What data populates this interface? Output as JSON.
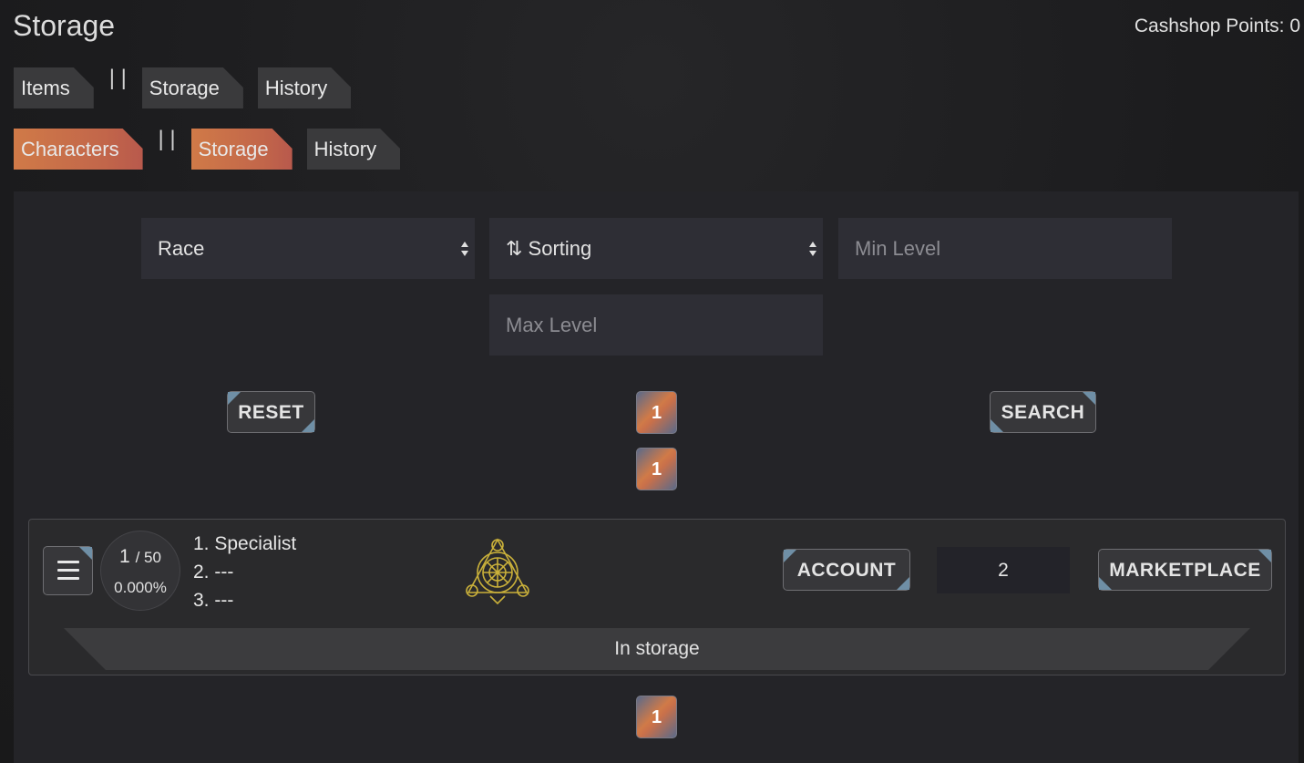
{
  "header": {
    "title": "Storage",
    "cashshop_label": "Cashshop Points: 0"
  },
  "items_tabs": {
    "items": "Items",
    "separator": "| |",
    "storage": "Storage",
    "history": "History"
  },
  "character_tabs": {
    "characters": "Characters",
    "separator": "| |",
    "storage": "Storage",
    "history": "History"
  },
  "filters": {
    "race": "Race",
    "sorting": "⇅ Sorting",
    "min_level_placeholder": "Min Level",
    "max_level_placeholder": "Max Level"
  },
  "buttons": {
    "reset": "RESET",
    "search": "SEARCH",
    "account": "ACCOUNT",
    "marketplace": "MARKETPLACE"
  },
  "pagination": {
    "top_page_1": "1",
    "top_page_2": "1",
    "bottom_page": "1"
  },
  "character": {
    "level": "1",
    "level_max": "/ 50",
    "exp_percent": "0.000%",
    "specs": [
      "1. Specialist",
      "2. ---",
      "3. ---"
    ],
    "quantity": "2",
    "status": "In storage"
  },
  "icons": {
    "menu": "hamburger-menu-icon",
    "emblem": "class-emblem-icon"
  },
  "colors": {
    "active_tab": "#d07a48",
    "corner_accent": "#6f8fa6"
  }
}
